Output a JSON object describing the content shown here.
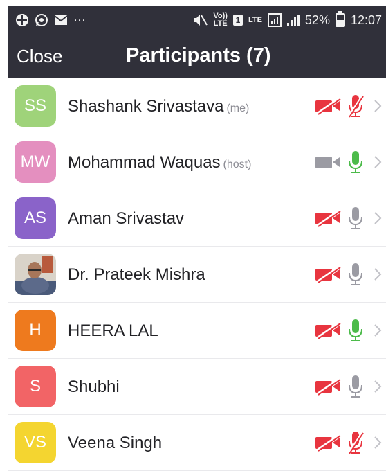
{
  "status_bar": {
    "battery": "52%",
    "time": "12:07",
    "volte": [
      "Vo))",
      "LTE"
    ],
    "sim_badge": "1",
    "lte": "LTE"
  },
  "header": {
    "close_label": "Close",
    "title": "Participants (7)"
  },
  "participants": [
    {
      "initials": "SS",
      "name": "Shashank Srivastava",
      "tag": "(me)",
      "avatar_color": "#9fd37a",
      "video": "off",
      "audio": "muted"
    },
    {
      "initials": "MW",
      "name": "Mohammad Waquas",
      "tag": "(host)",
      "avatar_color": "#e48fbf",
      "video": "on",
      "audio": "active"
    },
    {
      "initials": "AS",
      "name": "Aman Srivastav",
      "tag": "",
      "avatar_color": "#8a63c9",
      "video": "off",
      "audio": "idle"
    },
    {
      "initials": "",
      "name": "Dr. Prateek Mishra",
      "tag": "",
      "avatar_color": "#cfc8be",
      "video": "off",
      "audio": "idle",
      "avatar_type": "photo"
    },
    {
      "initials": "H",
      "name": "HEERA LAL",
      "tag": "",
      "avatar_color": "#ee7a1e",
      "video": "off",
      "audio": "active"
    },
    {
      "initials": "S",
      "name": "Shubhi",
      "tag": "",
      "avatar_color": "#f26466",
      "video": "off",
      "audio": "idle"
    },
    {
      "initials": "VS",
      "name": "Veena Singh",
      "tag": "",
      "avatar_color": "#f4d530",
      "video": "off",
      "audio": "muted"
    }
  ],
  "colors": {
    "header_bg": "#30303a",
    "muted_red": "#e8353f",
    "active_green": "#4cbb4a",
    "idle_grey": "#9b9ba3"
  }
}
